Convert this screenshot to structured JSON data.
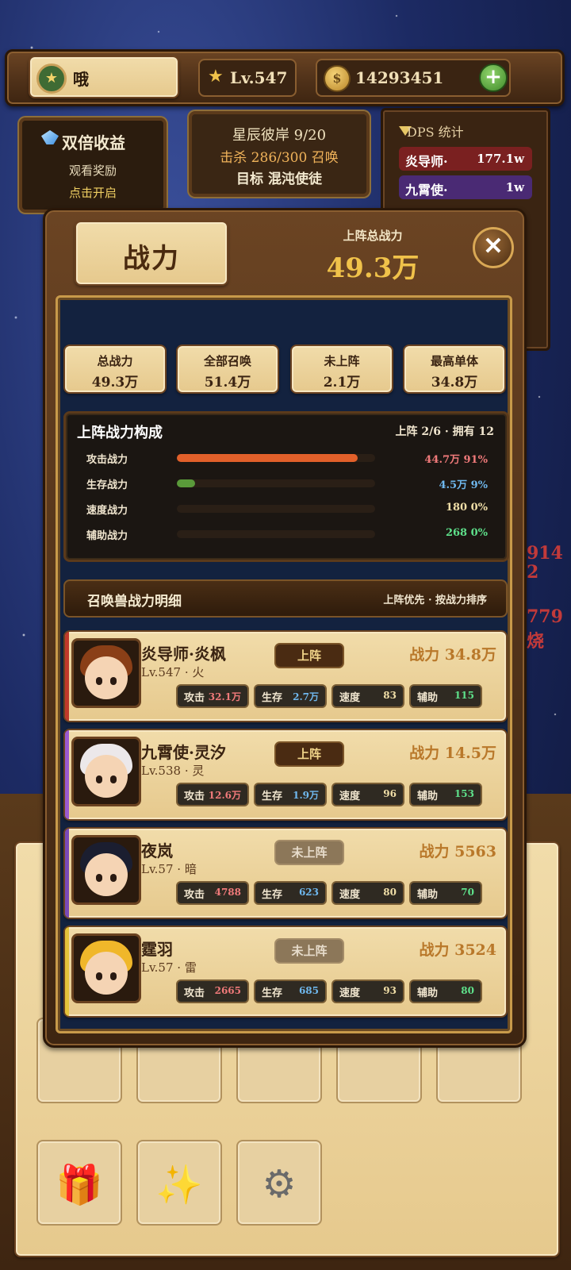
{
  "topbar": {
    "player_name": "哦",
    "level": "Lv.547",
    "gold": "14293451",
    "gold_add": "+",
    "badge_icon": "star-badge-icon"
  },
  "double_income": {
    "title": "双倍收益",
    "subtitle": "观看奖励",
    "action": "点击开启"
  },
  "stage": {
    "line1": "星辰彼岸  9/20",
    "line2": "击杀 286/300 召唤",
    "line3": "目标 混沌使徒"
  },
  "dps": {
    "title": "DPS 统计",
    "rows": [
      {
        "name": "炎导师·",
        "value": "177.1w",
        "color": "#7a2020"
      },
      {
        "name": "九霄使·",
        "value": "1w",
        "color": "#4a2a74"
      }
    ]
  },
  "background_numbers": [
    "914",
    "2",
    "779",
    "烧"
  ],
  "panel": {
    "title": "战力",
    "total_label": "上阵总战力",
    "total_value": "49.3万",
    "close": "✕",
    "stats": [
      {
        "label": "总战力",
        "value": "49.3万"
      },
      {
        "label": "全部召唤",
        "value": "51.4万"
      },
      {
        "label": "未上阵",
        "value": "2.1万"
      },
      {
        "label": "最高单体",
        "value": "34.8万"
      }
    ],
    "composition": {
      "title": "上阵战力构成",
      "summary": "上阵 2/6 · 拥有 12",
      "rows": [
        {
          "label": "攻击战力",
          "value": "44.7万  91%",
          "percent": 91,
          "color": "#e2602a",
          "text_color": "#f07a7a"
        },
        {
          "label": "生存战力",
          "value": "4.5万  9%",
          "percent": 9,
          "color": "#5a9a3a",
          "text_color": "#6fb8ee"
        },
        {
          "label": "速度战力",
          "value": "180  0%",
          "percent": 0,
          "color": "#9a8a5a",
          "text_color": "#f1dfa8"
        },
        {
          "label": "辅助战力",
          "value": "268  0%",
          "percent": 0,
          "color": "#3a9a5a",
          "text_color": "#5ee08a"
        }
      ]
    },
    "list": {
      "title": "召唤兽战力明细",
      "sort": "上阵优先 · 按战力排序",
      "cards": [
        {
          "name": "炎导师·炎枫",
          "level": "Lv.547 · 火",
          "status": "上阵",
          "deployed": true,
          "power": "战力 34.8万",
          "strip": "#c0392b",
          "hair": "#8a3f17",
          "attack": "32.1万",
          "survive": "2.7万",
          "speed": "83",
          "assist": "115"
        },
        {
          "name": "九霄使·灵汐",
          "level": "Lv.538 · 灵",
          "status": "上阵",
          "deployed": true,
          "power": "战力 14.5万",
          "strip": "#9b5ad0",
          "hair": "#ece8ea",
          "attack": "12.6万",
          "survive": "1.9万",
          "speed": "96",
          "assist": "153"
        },
        {
          "name": "夜岚",
          "level": "Lv.57 · 暗",
          "status": "未上阵",
          "deployed": false,
          "power": "战力 5563",
          "strip": "#7a4ab8",
          "hair": "#1b1e30",
          "attack": "4788",
          "survive": "623",
          "speed": "80",
          "assist": "70"
        },
        {
          "name": "霆羽",
          "level": "Lv.57 · 雷",
          "status": "未上阵",
          "deployed": false,
          "power": "战力 3524",
          "strip": "#e3c23a",
          "hair": "#f0b72a",
          "attack": "2665",
          "survive": "685",
          "speed": "93",
          "assist": "80"
        }
      ],
      "chip_labels": {
        "attack": "攻击",
        "survive": "生存",
        "speed": "速度",
        "assist": "辅助"
      }
    }
  },
  "bottom_slots": [
    {
      "icon": "gift-icon",
      "glyph": "🎁"
    },
    {
      "icon": "sparkle-icon",
      "glyph": "✨"
    },
    {
      "icon": "gear-icon",
      "glyph": "⚙"
    }
  ]
}
